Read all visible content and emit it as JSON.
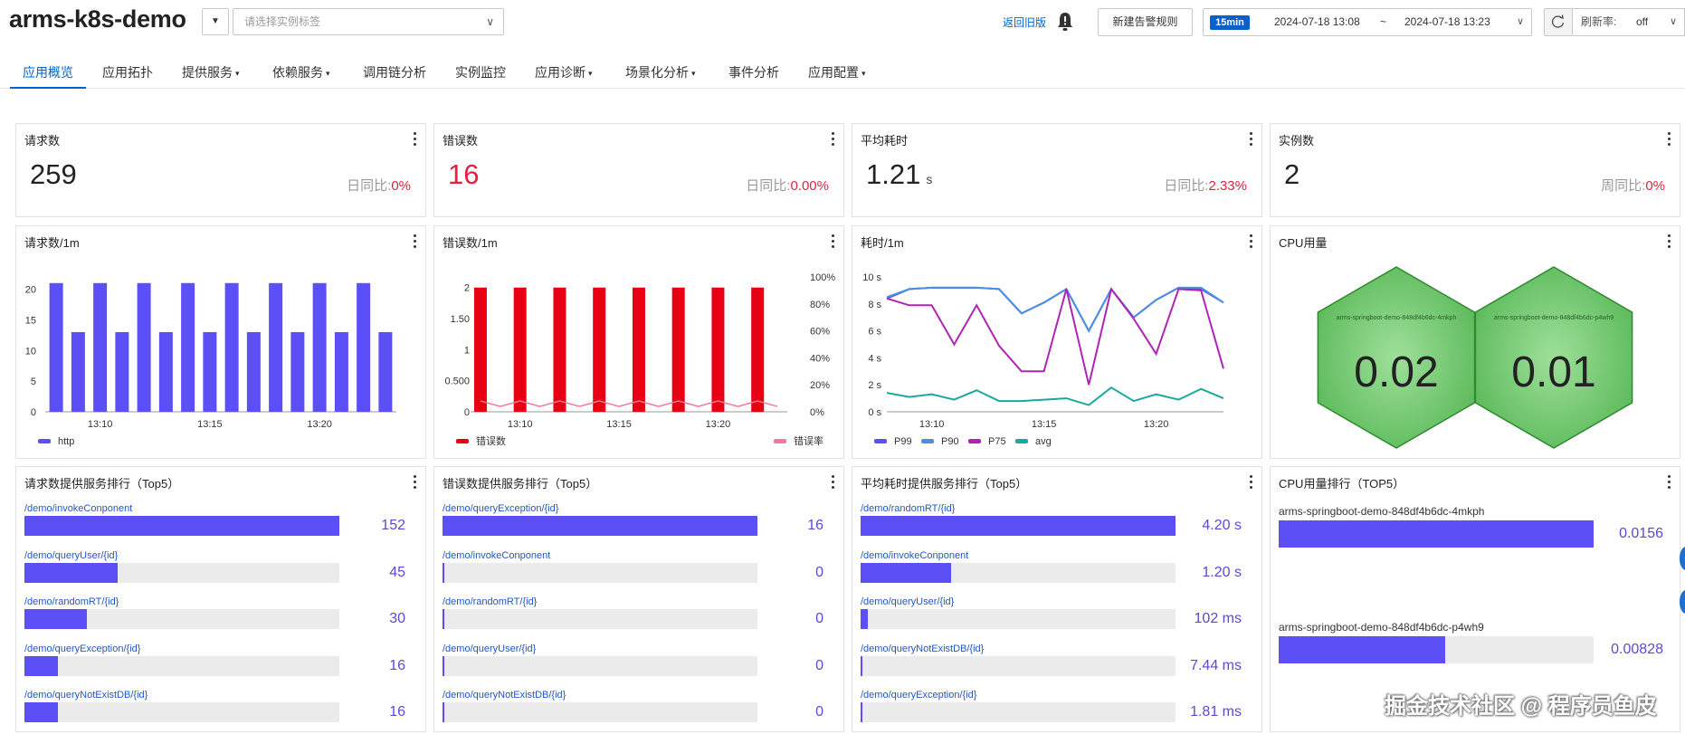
{
  "header": {
    "app_title": "arms-k8s-demo",
    "tag_placeholder": "请选择实例标签",
    "back_old": "返回旧版",
    "new_alert": "新建告警规则",
    "time_badge": "15min",
    "time_start": "2024-07-18 13:08",
    "time_sep": "~",
    "time_end": "2024-07-18 13:23",
    "refresh_label": "刷新率:",
    "refresh_value": "off"
  },
  "nav": {
    "tabs": [
      {
        "label": "应用概览",
        "dropdown": false
      },
      {
        "label": "应用拓扑",
        "dropdown": false
      },
      {
        "label": "提供服务",
        "dropdown": true
      },
      {
        "label": "依赖服务",
        "dropdown": true
      },
      {
        "label": "调用链分析",
        "dropdown": false
      },
      {
        "label": "实例监控",
        "dropdown": false
      },
      {
        "label": "应用诊断",
        "dropdown": true
      },
      {
        "label": "场景化分析",
        "dropdown": true
      },
      {
        "label": "事件分析",
        "dropdown": false
      },
      {
        "label": "应用配置",
        "dropdown": true
      }
    ],
    "caret": "▾"
  },
  "kpis": [
    {
      "title": "请求数",
      "value": "259",
      "unit": "",
      "cmp_label": "日同比:",
      "cmp_value": "0%",
      "red": false
    },
    {
      "title": "错误数",
      "value": "16",
      "unit": "",
      "cmp_label": "日同比:",
      "cmp_value": "0.00%",
      "red": true
    },
    {
      "title": "平均耗时",
      "value": "1.21",
      "unit": "s",
      "cmp_label": "日同比:",
      "cmp_value": "2.33%",
      "red": false
    },
    {
      "title": "实例数",
      "value": "2",
      "unit": "",
      "cmp_label": "周同比:",
      "cmp_value": "0%",
      "red": false
    }
  ],
  "chart_data": [
    {
      "type": "bar",
      "title": "请求数/1m",
      "x": [
        "13:08",
        "13:09",
        "13:10",
        "13:11",
        "13:12",
        "13:13",
        "13:14",
        "13:15",
        "13:16",
        "13:17",
        "13:18",
        "13:19",
        "13:20",
        "13:21",
        "13:22",
        "13:23"
      ],
      "x_tick_labels": [
        "13:10",
        "13:15",
        "13:20"
      ],
      "y_ticks": [
        "0",
        "5",
        "10",
        "15",
        "20"
      ],
      "ylim": [
        0,
        22
      ],
      "series": [
        {
          "name": "http",
          "color": "#5b4ff5",
          "values": [
            21,
            13,
            21,
            13,
            21,
            13,
            21,
            13,
            21,
            13,
            21,
            13,
            21,
            13,
            21,
            13
          ]
        }
      ],
      "legend": "bottom-left"
    },
    {
      "type": "bar",
      "title": "错误数/1m",
      "x": [
        "13:08",
        "13:09",
        "13:10",
        "13:11",
        "13:12",
        "13:13",
        "13:14",
        "13:15",
        "13:16",
        "13:17",
        "13:18",
        "13:19",
        "13:20",
        "13:21",
        "13:22",
        "13:23"
      ],
      "x_tick_labels": [
        "13:10",
        "13:15",
        "13:20"
      ],
      "y_ticks": [
        "0",
        "0.500",
        "1",
        "1.50",
        "2"
      ],
      "y2_ticks": [
        "0%",
        "20%",
        "40%",
        "60%",
        "80%",
        "100%"
      ],
      "ylim": [
        0,
        2.2
      ],
      "series": [
        {
          "name": "错误数",
          "color": "#e60012",
          "values": [
            2,
            0,
            2,
            0,
            2,
            0,
            2,
            0,
            2,
            0,
            2,
            0,
            2,
            0,
            2,
            0
          ]
        },
        {
          "name": "错误率",
          "color": "#f07a9a",
          "axis": "right",
          "values": [
            8,
            4,
            8,
            4,
            8,
            4,
            8,
            4,
            8,
            4,
            8,
            4,
            8,
            4,
            8,
            4
          ]
        }
      ],
      "legend": "bottom"
    },
    {
      "type": "line",
      "title": "耗时/1m",
      "x": [
        "13:08",
        "13:09",
        "13:10",
        "13:11",
        "13:12",
        "13:13",
        "13:14",
        "13:15",
        "13:16",
        "13:17",
        "13:18",
        "13:19",
        "13:20",
        "13:21",
        "13:22",
        "13:23"
      ],
      "x_tick_labels": [
        "13:10",
        "13:15",
        "13:20"
      ],
      "y_ticks": [
        "0 s",
        "2 s",
        "4 s",
        "6 s",
        "8 s",
        "10 s"
      ],
      "ylim": [
        0,
        10
      ],
      "series": [
        {
          "name": "P99",
          "color": "#5b4ff5",
          "values": [
            8.4,
            9.1,
            9.2,
            9.2,
            9.2,
            9.1,
            7.3,
            8.1,
            9.1,
            6.0,
            9.1,
            7.0,
            8.3,
            9.2,
            9.1,
            8.1
          ]
        },
        {
          "name": "P90",
          "color": "#4a90e2",
          "values": [
            8.5,
            9.1,
            9.2,
            9.2,
            9.2,
            9.1,
            7.3,
            8.1,
            9.1,
            6.0,
            9.1,
            7.0,
            8.3,
            9.2,
            9.2,
            8.1
          ]
        },
        {
          "name": "P75",
          "color": "#b023b6",
          "values": [
            8.4,
            7.9,
            7.9,
            5.0,
            7.9,
            4.9,
            3.0,
            3.0,
            9.1,
            2.0,
            9.1,
            6.9,
            4.3,
            9.1,
            9.0,
            3.2
          ]
        },
        {
          "name": "avg",
          "color": "#1aa89e",
          "values": [
            1.4,
            1.1,
            1.3,
            0.9,
            1.6,
            0.8,
            0.8,
            0.9,
            1.0,
            0.5,
            1.8,
            0.8,
            1.3,
            0.9,
            1.7,
            1.0
          ]
        }
      ],
      "legend": "bottom-left"
    },
    {
      "type": "heatmap",
      "title": "CPU用量",
      "items": [
        {
          "name": "arms-springboot-demo-848df4b6dc-4mkph",
          "value": "0.02"
        },
        {
          "name": "arms-springboot-demo-848df4b6dc-p4wh9",
          "value": "0.01"
        }
      ],
      "color": "#6ccf6c"
    }
  ],
  "rankings": [
    {
      "title": "请求数提供服务排行（Top5）",
      "rows": [
        {
          "label": "/demo/invokeConponent",
          "value": "152",
          "frac": 1.0
        },
        {
          "label": "/demo/queryUser/{id}",
          "value": "45",
          "frac": 0.296
        },
        {
          "label": "/demo/randomRT/{id}",
          "value": "30",
          "frac": 0.197
        },
        {
          "label": "/demo/queryException/{id}",
          "value": "16",
          "frac": 0.105
        },
        {
          "label": "/demo/queryNotExistDB/{id}",
          "value": "16",
          "frac": 0.105
        }
      ]
    },
    {
      "title": "错误数提供服务排行（Top5）",
      "rows": [
        {
          "label": "/demo/queryException/{id}",
          "value": "16",
          "frac": 1.0
        },
        {
          "label": "/demo/invokeConponent",
          "value": "0",
          "frac": 0.004
        },
        {
          "label": "/demo/randomRT/{id}",
          "value": "0",
          "frac": 0.004
        },
        {
          "label": "/demo/queryUser/{id}",
          "value": "0",
          "frac": 0.004
        },
        {
          "label": "/demo/queryNotExistDB/{id}",
          "value": "0",
          "frac": 0.004
        }
      ]
    },
    {
      "title": "平均耗时提供服务排行（Top5）",
      "rows": [
        {
          "label": "/demo/randomRT/{id}",
          "value": "4.20 s",
          "frac": 1.0
        },
        {
          "label": "/demo/invokeConponent",
          "value": "1.20 s",
          "frac": 0.286
        },
        {
          "label": "/demo/queryUser/{id}",
          "value": "102 ms",
          "frac": 0.024
        },
        {
          "label": "/demo/queryNotExistDB/{id}",
          "value": "7.44 ms",
          "frac": 0.004
        },
        {
          "label": "/demo/queryException/{id}",
          "value": "1.81 ms",
          "frac": 0.004
        }
      ]
    },
    {
      "title": "CPU用量排行（TOP5）",
      "rows": [
        {
          "label": "arms-springboot-demo-848df4b6dc-4mkph",
          "value": "0.0156",
          "frac": 1.0
        },
        {
          "label": "arms-springboot-demo-848df4b6dc-p4wh9",
          "value": "0.00828",
          "frac": 0.53
        }
      ]
    }
  ],
  "watermark": "掘金技术社区 @ 程序员鱼皮"
}
